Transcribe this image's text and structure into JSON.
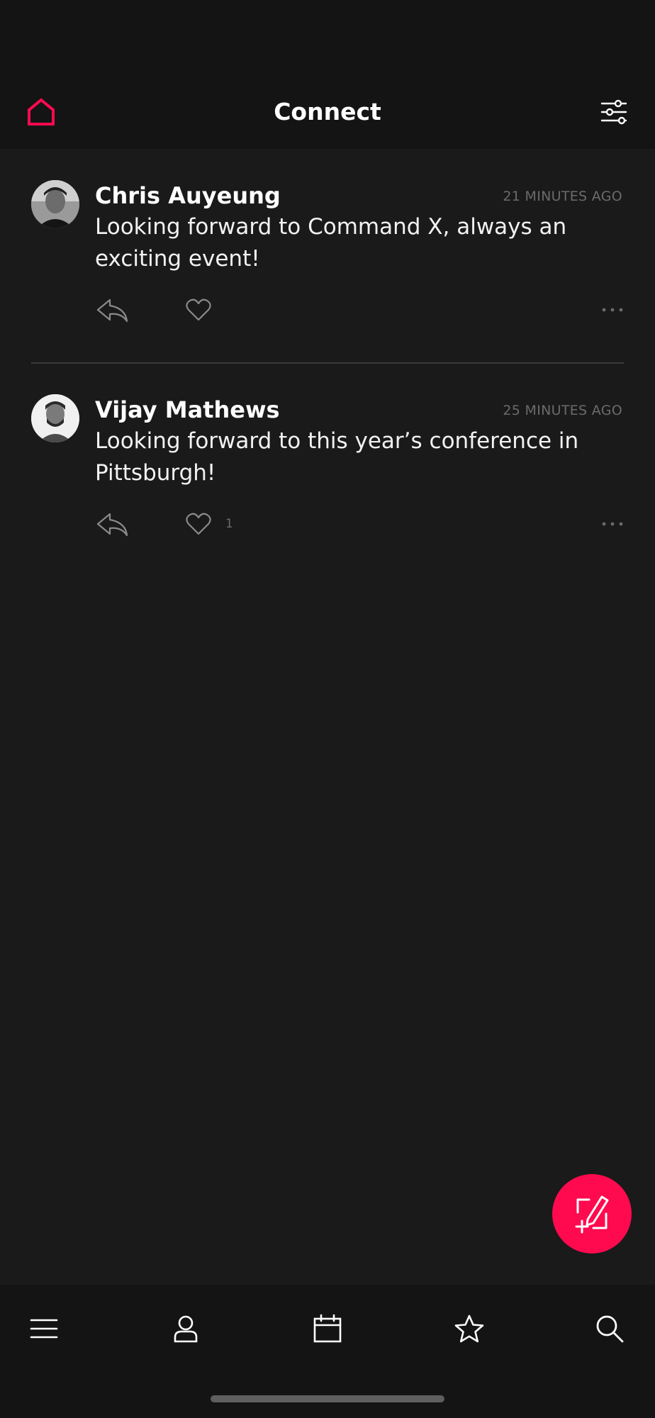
{
  "header": {
    "title": "Connect",
    "home_icon": "home-icon",
    "filter_icon": "sliders-icon"
  },
  "colors": {
    "accent": "#ff0a4f",
    "background": "#1a1a1a",
    "bar_background": "#141414",
    "muted_text": "#6b6b6b"
  },
  "posts": [
    {
      "author": "Chris Auyeung",
      "time": "21 MINUTES AGO",
      "body": "Looking forward to Command X, always an exciting event!",
      "like_count": ""
    },
    {
      "author": "Vijay Mathews",
      "time": "25 MINUTES AGO",
      "body": "Looking forward to this year’s conference in Pittsburgh!",
      "like_count": "1"
    }
  ],
  "fab": {
    "icon": "compose-icon"
  },
  "tabbar": {
    "items": [
      {
        "icon": "menu-icon"
      },
      {
        "icon": "person-icon"
      },
      {
        "icon": "calendar-icon"
      },
      {
        "icon": "star-icon"
      },
      {
        "icon": "search-icon"
      }
    ]
  }
}
